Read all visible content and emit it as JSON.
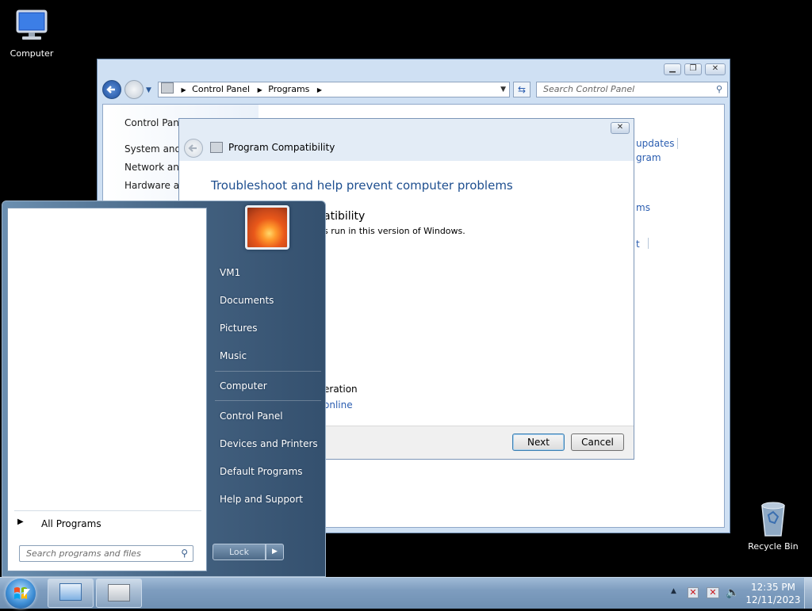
{
  "desktop": {
    "icons": [
      {
        "label": "Computer",
        "icon": "computer-icon"
      },
      {
        "label": "Recycle Bin",
        "icon": "recycle-bin-icon"
      }
    ]
  },
  "control_panel": {
    "address": {
      "root": "Control Panel",
      "path": "Programs"
    },
    "search_placeholder": "Search Control Panel",
    "left_nav": [
      "Control Panel",
      "System and S",
      "Network and",
      "Hardware and"
    ],
    "right_links": [
      "updates",
      "gram",
      "ms",
      "t"
    ]
  },
  "dialog": {
    "title": "Program Compatibility",
    "heading": "Troubleshoot and help prevent computer problems",
    "section_title": "atibility",
    "section_text": "s run in this version of Windows.",
    "fragment_1": "eration",
    "fragment_2": "online",
    "next_label": "Next",
    "cancel_label": "Cancel"
  },
  "start_menu": {
    "all_programs": "All Programs",
    "search_placeholder": "Search programs and files",
    "items": [
      "VM1",
      "Documents",
      "Pictures",
      "Music",
      "Computer",
      "Control Panel",
      "Devices and Printers",
      "Default Programs",
      "Help and Support"
    ],
    "lock_label": "Lock"
  },
  "taskbar": {
    "time": "12:35 PM",
    "date": "12/11/2023"
  },
  "colors": {
    "accent": "#1e5ba8",
    "heading_blue": "#1d4e8f",
    "link_blue": "#2a5db0"
  }
}
